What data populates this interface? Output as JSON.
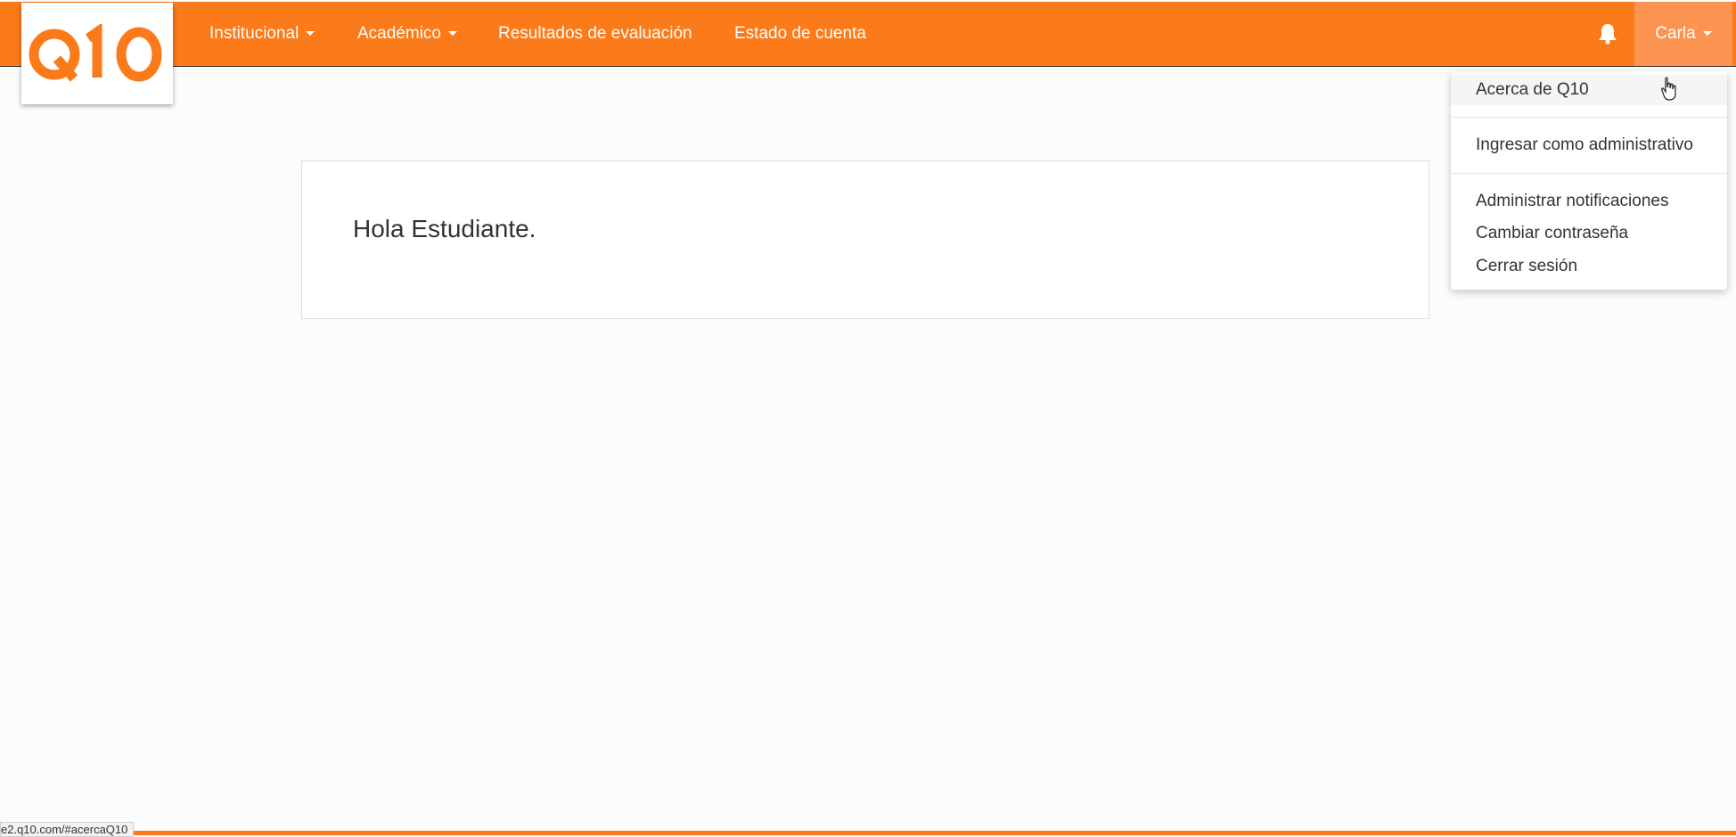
{
  "brand": {
    "logo_text": "Q10",
    "color": "#fb7a1a"
  },
  "nav": {
    "items": [
      {
        "label": "Institucional",
        "has_dropdown": true
      },
      {
        "label": "Académico",
        "has_dropdown": true
      },
      {
        "label": "Resultados de evaluación",
        "has_dropdown": false
      },
      {
        "label": "Estado de cuenta",
        "has_dropdown": false
      }
    ],
    "notification_icon": "bell-icon",
    "user_name": "Carla"
  },
  "main": {
    "greeting": "Hola Estudiante."
  },
  "user_dropdown": {
    "items": [
      {
        "label": "Acerca de Q10"
      },
      {
        "label": "Ingresar como administrativo"
      },
      {
        "label": "Administrar notificaciones"
      },
      {
        "label": "Cambiar contraseña"
      },
      {
        "label": "Cerrar sesión"
      }
    ]
  },
  "status_bar": {
    "url": "e2.q10.com/#acercaQ10"
  }
}
